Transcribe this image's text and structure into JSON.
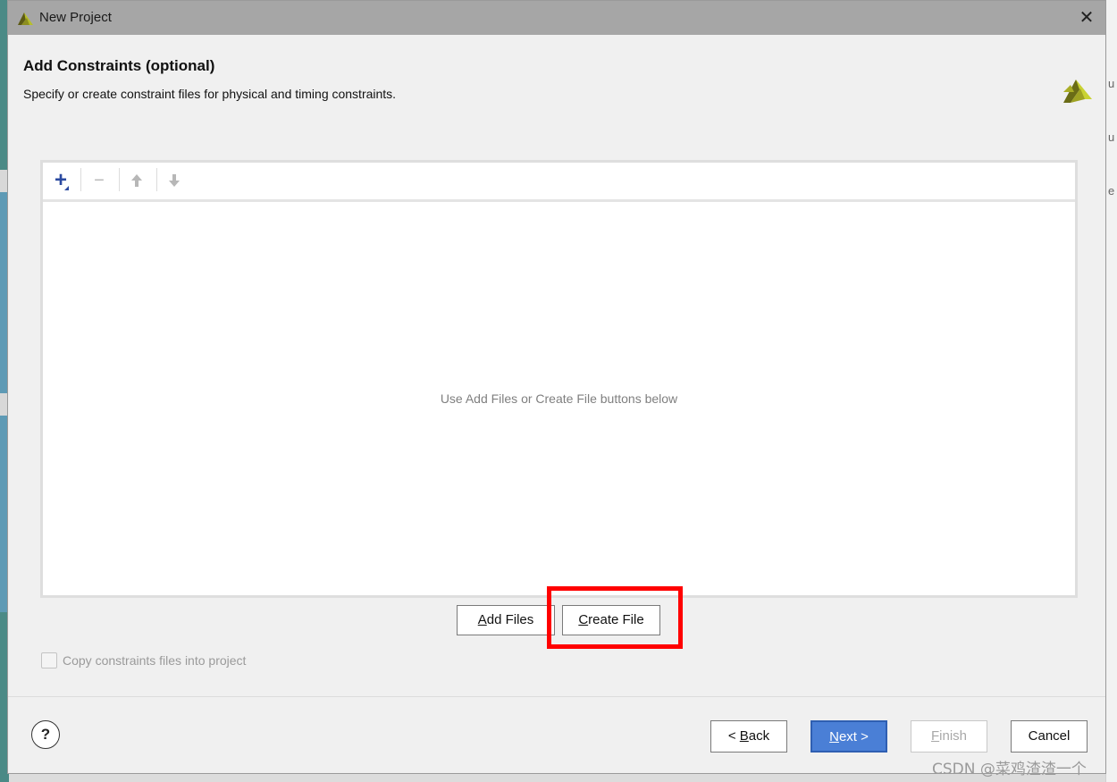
{
  "window": {
    "title": "New Project"
  },
  "header": {
    "title": "Add Constraints (optional)",
    "subtitle": "Specify or create constraint files for physical and timing constraints."
  },
  "toolbar": {
    "add_icon": "plus-icon",
    "remove_icon": "minus-icon",
    "move_up_icon": "arrow-up-icon",
    "move_down_icon": "arrow-down-icon"
  },
  "file_list": {
    "empty_message": "Use Add Files or Create File buttons below"
  },
  "buttons": {
    "add_files_prefix": "A",
    "add_files_rest": "dd Files",
    "create_file_prefix": "C",
    "create_file_rest": "reate File"
  },
  "options": {
    "copy_label": "Copy constraints files into project",
    "copy_checked": false
  },
  "footer": {
    "help_label": "?",
    "back_prefix": "< ",
    "back_mnemonic": "B",
    "back_rest": "ack",
    "next_mnemonic": "N",
    "next_rest": "ext >",
    "finish_mnemonic": "F",
    "finish_rest": "inish",
    "cancel_label": "Cancel"
  },
  "watermark": "CSDN @菜鸡渣渣一个",
  "colors": {
    "highlight": "#ff0000",
    "primary_button": "#4a7fd6",
    "title_bar": "#a6a6a6"
  }
}
